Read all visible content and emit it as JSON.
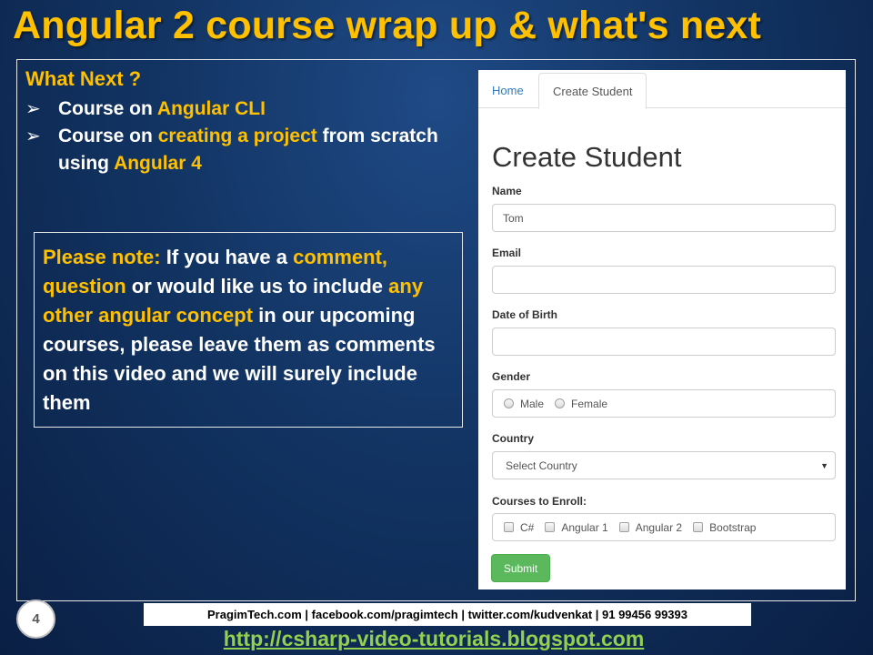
{
  "slide": {
    "title": "Angular 2 course wrap up & what's next",
    "what_next": {
      "heading": "What Next ?",
      "bullet_icon": "arrow-bullet-icon",
      "items": [
        {
          "p1": "Course on ",
          "h1": "Angular CLI"
        },
        {
          "p1": "Course on ",
          "h1": "creating a project",
          "p2": " from scratch using ",
          "h2": "Angular 4"
        }
      ]
    },
    "note": {
      "label": "Please note:",
      "t1": " If you have a ",
      "h1": "comment, question",
      "t2": " or would like us to include ",
      "h2": "any other angular concept",
      "t3": " in our upcoming courses, please leave them as comments on this video and we will surely include them"
    },
    "page_number": "4",
    "contact": "PragimTech.com | facebook.com/pragimtech  | twitter.com/kudvenkat  | 91 99456 99393",
    "link": "http://csharp-video-tutorials.blogspot.com",
    "colors": {
      "accent": "#ffc000",
      "link": "#92d050",
      "submit": "#5cb85c",
      "tab_link": "#337ab7"
    }
  },
  "app": {
    "tabs": {
      "home": "Home",
      "create": "Create Student"
    },
    "heading": "Create Student",
    "fields": {
      "name": {
        "label": "Name",
        "value": "Tom"
      },
      "email": {
        "label": "Email",
        "value": ""
      },
      "dob": {
        "label": "Date of Birth",
        "value": ""
      },
      "gender": {
        "label": "Gender",
        "options": [
          "Male",
          "Female"
        ]
      },
      "country": {
        "label": "Country",
        "selected": "Select Country"
      },
      "courses": {
        "label": "Courses to Enroll:",
        "options": [
          "C#",
          "Angular 1",
          "Angular 2",
          "Bootstrap"
        ]
      }
    },
    "submit_label": "Submit"
  }
}
